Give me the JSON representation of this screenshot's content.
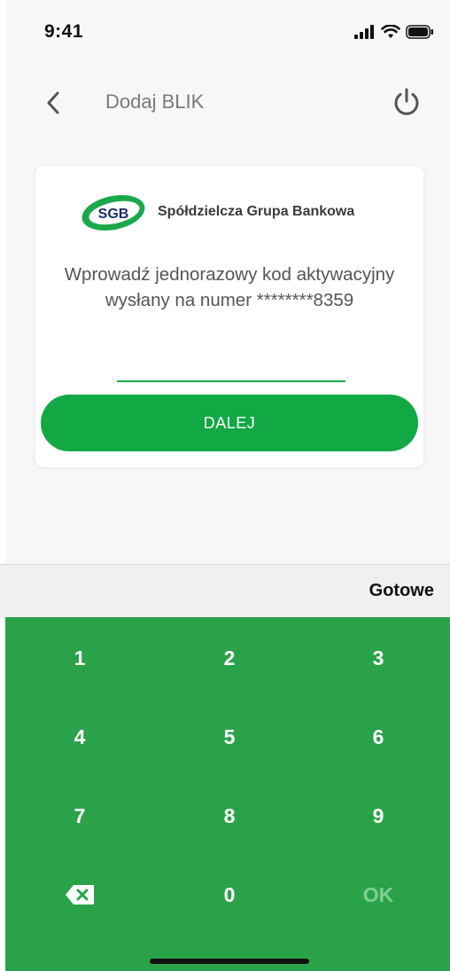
{
  "status_bar": {
    "time": "9:41"
  },
  "header": {
    "title": "Dodaj BLIK",
    "back_icon": "chevron-left-icon",
    "power_icon": "power-icon"
  },
  "card": {
    "logo_mark": "SGB",
    "logo_text": "Spółdzielcza Grupa Bankowa",
    "instruction_line1": "Wprowadź jednorazowy kod aktywacyjny",
    "instruction_line2": "wysłany na numer ********8359",
    "code_value": "",
    "next_label": "DALEJ"
  },
  "accessory": {
    "done_label": "Gotowe"
  },
  "keypad": {
    "keys": [
      "1",
      "2",
      "3",
      "4",
      "5",
      "6",
      "7",
      "8",
      "9"
    ],
    "zero": "0",
    "ok": "OK",
    "backspace_icon": "backspace-icon"
  },
  "colors": {
    "brand_green": "#12a844",
    "keypad_green": "#2aa24a",
    "input_underline": "#1da94a"
  }
}
